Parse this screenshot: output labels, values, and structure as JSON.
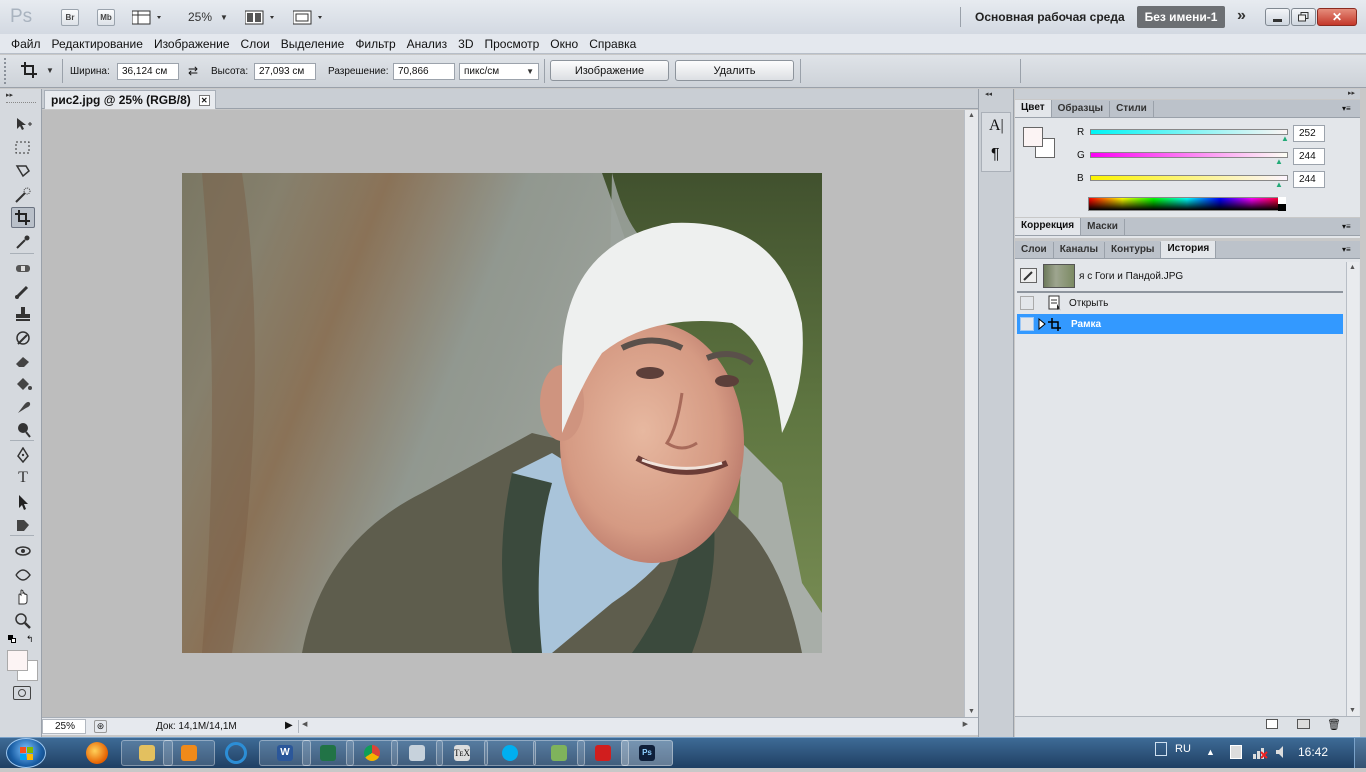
{
  "titlebar": {
    "app_logo": "Ps",
    "bridge_label": "Br",
    "minibridge_label": "Mb",
    "zoom": "25%",
    "workspace": "Основная рабочая среда",
    "document_name": "Без имени-1",
    "more_symbol": "»"
  },
  "menu": [
    "Файл",
    "Редактирование",
    "Изображение",
    "Слои",
    "Выделение",
    "Фильтр",
    "Анализ",
    "3D",
    "Просмотр",
    "Окно",
    "Справка"
  ],
  "options": {
    "width_label": "Ширина:",
    "width_value": "36,124 см",
    "height_label": "Высота:",
    "height_value": "27,093 см",
    "resolution_label": "Разрешение:",
    "resolution_value": "70,866",
    "resolution_unit": "пикс/см",
    "image_button": "Изображение",
    "delete_button": "Удалить"
  },
  "document": {
    "tab_title": "рис2.jpg @ 25% (RGB/8)",
    "status_zoom": "25%",
    "status_doc": "Док: 14,1M/14,1M"
  },
  "color_panel": {
    "tabs": [
      "Цвет",
      "Образцы",
      "Стили"
    ],
    "r_label": "R",
    "r_value": "252",
    "g_label": "G",
    "g_value": "244",
    "b_label": "B",
    "b_value": "244",
    "foreground_color": "#fcf4f4"
  },
  "adjust_panel": {
    "tabs": [
      "Коррекция",
      "Маски"
    ]
  },
  "history_panel": {
    "tabs": [
      "Слои",
      "Каналы",
      "Контуры",
      "История"
    ],
    "snapshot_name": "я с Гоги и Пандой.JPG",
    "steps": [
      {
        "label": "Открыть",
        "selected": false
      },
      {
        "label": "Рамка",
        "selected": true
      }
    ]
  },
  "taskbar": {
    "language": "RU",
    "time": "16:42"
  },
  "colors": {
    "accent_selected": "#3399ff",
    "doc_name_bg": "#6c6f73"
  }
}
